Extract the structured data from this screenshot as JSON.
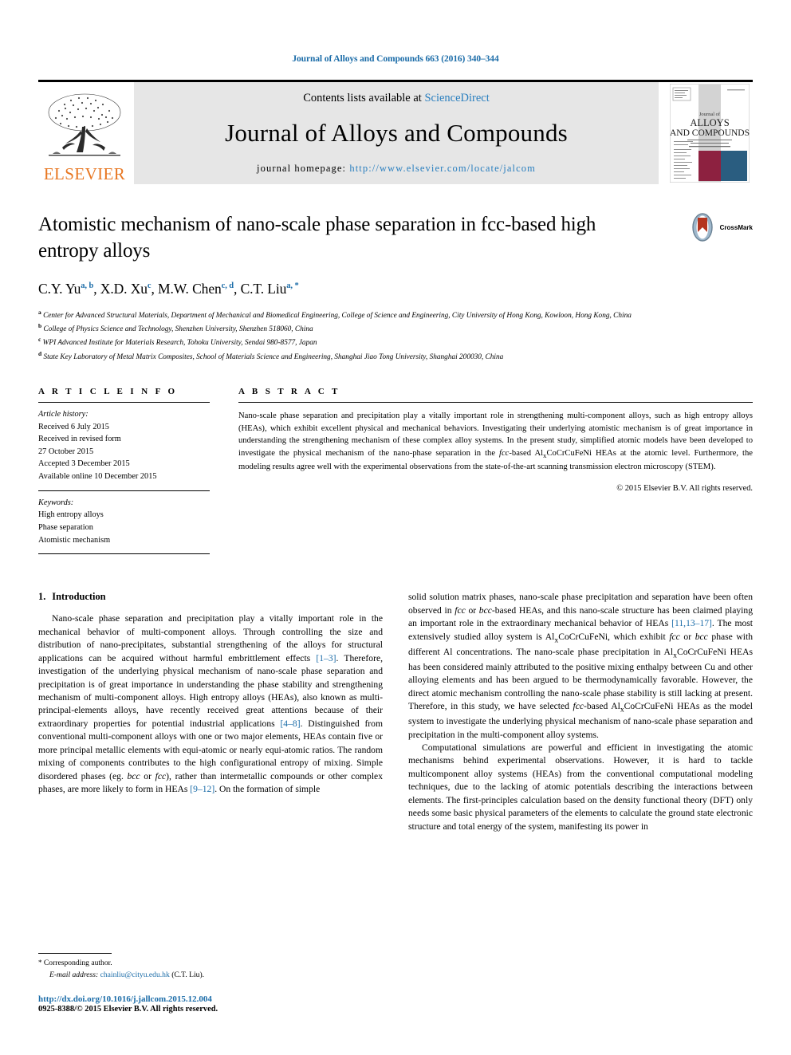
{
  "running_head": "Journal of Alloys and Compounds 663 (2016) 340–344",
  "masthead": {
    "contents_prefix": "Contents lists available at ",
    "sciencedirect": "ScienceDirect",
    "journal_title": "Journal of Alloys and Compounds",
    "homepage_prefix": "journal homepage: ",
    "homepage_url": "http://www.elsevier.com/locate/jalcom",
    "publisher_name": "ELSEVIER",
    "cover_lines": [
      "Journal of",
      "ALLOYS",
      "AND COMPOUNDS"
    ],
    "link_color": "#2a7fbf",
    "publisher_color": "#E87722"
  },
  "title": "Atomistic mechanism of nano-scale phase separation in fcc-based high entropy alloys",
  "crossmark": {
    "label": "CrossMark"
  },
  "authors": "C.Y. Yu a, b, X.D. Xu c, M.W. Chen c, d, C.T. Liu a, *",
  "author_list": [
    {
      "name": "C.Y. Yu",
      "marks": "a, b"
    },
    {
      "name": "X.D. Xu",
      "marks": "c"
    },
    {
      "name": "M.W. Chen",
      "marks": "c, d"
    },
    {
      "name": "C.T. Liu",
      "marks": "a, *"
    }
  ],
  "affiliations": [
    {
      "mark": "a",
      "text": "Center for Advanced Structural Materials, Department of Mechanical and Biomedical Engineering, College of Science and Engineering, City University of Hong Kong, Kowloon, Hong Kong, China"
    },
    {
      "mark": "b",
      "text": "College of Physics Science and Technology, Shenzhen University, Shenzhen 518060, China"
    },
    {
      "mark": "c",
      "text": "WPI Advanced Institute for Materials Research, Tohoku University, Sendai 980-8577, Japan"
    },
    {
      "mark": "d",
      "text": "State Key Laboratory of Metal Matrix Composites, School of Materials Science and Engineering, Shanghai Jiao Tong University, Shanghai 200030, China"
    }
  ],
  "article_info": {
    "heading": "A R T I C L E   I N F O",
    "history_label": "Article history:",
    "history": [
      "Received 6 July 2015",
      "Received in revised form",
      "27 October 2015",
      "Accepted 3 December 2015",
      "Available online 10 December 2015"
    ],
    "keywords_label": "Keywords:",
    "keywords": [
      "High entropy alloys",
      "Phase separation",
      "Atomistic mechanism"
    ]
  },
  "abstract": {
    "heading": "A B S T R A C T",
    "text_part1": "Nano-scale phase separation and precipitation play a vitally important role in strengthening multi-component alloys, such as high entropy alloys (HEAs), which exhibit excellent physical and mechanical behaviors. Investigating their underlying atomistic mechanism is of great importance in understanding the strengthening mechanism of these complex alloy systems. In the present study, simplified atomic models have been developed to investigate the physical mechanism of the nano-phase separation in the ",
    "italic_fcc": "fcc",
    "text_part2": "-based Al",
    "sub_x": "x",
    "text_part3": "CoCrCuFeNi HEAs at the atomic level. Furthermore, the modeling results agree well with the experimental observations from the state-of-the-art scanning transmission electron microscopy (STEM).",
    "copyright": "© 2015 Elsevier B.V. All rights reserved."
  },
  "introduction": {
    "number": "1.",
    "heading": "Introduction",
    "col_left": {
      "p1_a": "Nano-scale phase separation and precipitation play a vitally important role in the mechanical behavior of multi-component alloys. Through controlling the size and distribution of nano-precipitates, substantial strengthening of the alloys for structural applications can be acquired without harmful embrittlement effects ",
      "ref1": "[1–3]",
      "p1_b": ". Therefore, investigation of the underlying physical mechanism of nano-scale phase separation and precipitation is of great importance in understanding the phase stability and strengthening mechanism of multi-component alloys. High entropy alloys (HEAs), also known as multi-principal-elements alloys, have recently received great attentions because of their extraordinary properties for potential industrial applications ",
      "ref2": "[4–8]",
      "p1_c": ". Distinguished from conventional multi-component alloys with one or two major elements, HEAs contain five or more principal metallic elements with equi-atomic or nearly equi-atomic ratios. The random mixing of components contributes to the high configurational entropy of mixing. Simple disordered phases (eg. ",
      "it_bcc": "bcc",
      "p1_d": " or ",
      "it_fcc": "fcc",
      "p1_e": "), rather than intermetallic compounds or other complex phases, are more likely to form in HEAs ",
      "ref3": "[9–12]",
      "p1_f": ". On the formation of simple"
    },
    "col_right": {
      "p1_a": "solid solution matrix phases, nano-scale phase precipitation and separation have been often observed in ",
      "it_fcc1": "fcc",
      "p1_b": " or ",
      "it_bcc1": "bcc",
      "p1_c": "-based HEAs, and this nano-scale structure has been claimed playing an important role in the extraordinary mechanical behavior of HEAs ",
      "ref1": "[11,13–17]",
      "p1_d": ". The most extensively studied alloy system is Al",
      "sub_x1": "x",
      "p1_e": "CoCrCuFeNi, which exhibit ",
      "it_fcc2": "fcc",
      "p1_f": " or ",
      "it_bcc2": "bcc",
      "p1_g": " phase with different Al concentrations. The nano-scale phase precipitation in Al",
      "sub_x2": "x",
      "p1_h": "CoCrCuFeNi HEAs has been considered mainly attributed to the positive mixing enthalpy between Cu and other alloying elements and has been argued to be thermodynamically favorable. However, the direct atomic mechanism controlling the nano-scale phase stability is still lacking at present. Therefore, in this study, we have selected ",
      "it_fcc3": "fcc",
      "p1_i": "-based Al",
      "sub_x3": "x",
      "p1_j": "CoCrCuFeNi HEAs as the model system to investigate the underlying physical mechanism of nano-scale phase separation and precipitation in the multi-component alloy systems.",
      "p2": "Computational simulations are powerful and efficient in investigating the atomic mechanisms behind experimental observations. However, it is hard to tackle multicomponent alloy systems (HEAs) from the conventional computational modeling techniques, due to the lacking of atomic potentials describing the interactions between elements. The first-principles calculation based on the density functional theory (DFT) only needs some basic physical parameters of the elements to calculate the ground state electronic structure and total energy of the system, manifesting its power in"
    }
  },
  "footnote": {
    "star": "*",
    "corresponding": "Corresponding author.",
    "email_label": "E-mail address:",
    "email": "chainliu@cityu.edu.hk",
    "email_owner": "(C.T. Liu).",
    "doi": "http://dx.doi.org/10.1016/j.jallcom.2015.12.004",
    "issn": "0925-8388/© 2015 Elsevier B.V. All rights reserved."
  }
}
